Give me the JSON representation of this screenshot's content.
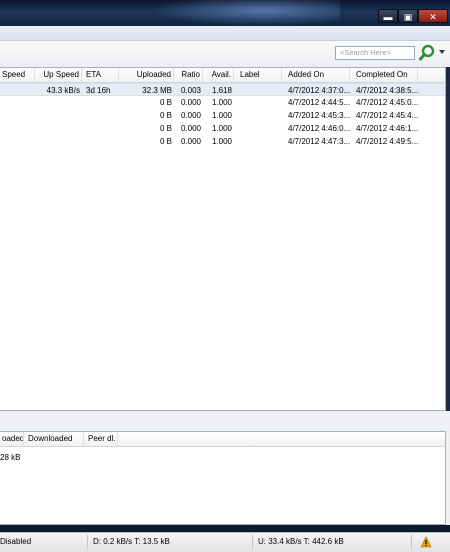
{
  "window": {
    "controls": {
      "minimize": "▬",
      "maximize": "▣",
      "close": "✕"
    }
  },
  "toolbar": {
    "search_placeholder": "<Search Here>"
  },
  "list": {
    "columns": [
      "Speed",
      "Up Speed",
      "ETA",
      "Uploaded",
      "Ratio",
      "Avail.",
      "Label",
      "Added On",
      "Completed On"
    ],
    "rows": [
      {
        "up_speed": "43.3 kB/s",
        "eta": "3d 16h",
        "uploaded": "32.3 MB",
        "ratio": "0.003",
        "avail": "1.618",
        "label": "",
        "added_on": "4/7/2012 4:37:0...",
        "completed_on": "4/7/2012 4:38:5..."
      },
      {
        "up_speed": "",
        "eta": "",
        "uploaded": "0 B",
        "ratio": "0.000",
        "avail": "1.000",
        "label": "",
        "added_on": "4/7/2012 4:44:5...",
        "completed_on": "4/7/2012 4:45:0..."
      },
      {
        "up_speed": "",
        "eta": "",
        "uploaded": "0 B",
        "ratio": "0.000",
        "avail": "1.000",
        "label": "",
        "added_on": "4/7/2012 4:45:3...",
        "completed_on": "4/7/2012 4:45:4..."
      },
      {
        "up_speed": "",
        "eta": "",
        "uploaded": "0 B",
        "ratio": "0.000",
        "avail": "1.000",
        "label": "",
        "added_on": "4/7/2012 4:46:0...",
        "completed_on": "4/7/2012 4:46:1..."
      },
      {
        "up_speed": "",
        "eta": "",
        "uploaded": "0 B",
        "ratio": "0.000",
        "avail": "1.000",
        "label": "",
        "added_on": "4/7/2012 4:47:3...",
        "completed_on": "4/7/2012 4:49:5..."
      }
    ]
  },
  "detail": {
    "columns": [
      "oaded",
      "Downloaded",
      "Peer dl."
    ],
    "row_value": "28 kB"
  },
  "status": {
    "dht": "Disabled",
    "download": "D: 0.2 kB/s T: 13.5 kB",
    "upload": "U: 33.4 kB/s T: 442.6 kB",
    "warning_icon": "warning-icon",
    "warning_color": "#f0a000"
  }
}
